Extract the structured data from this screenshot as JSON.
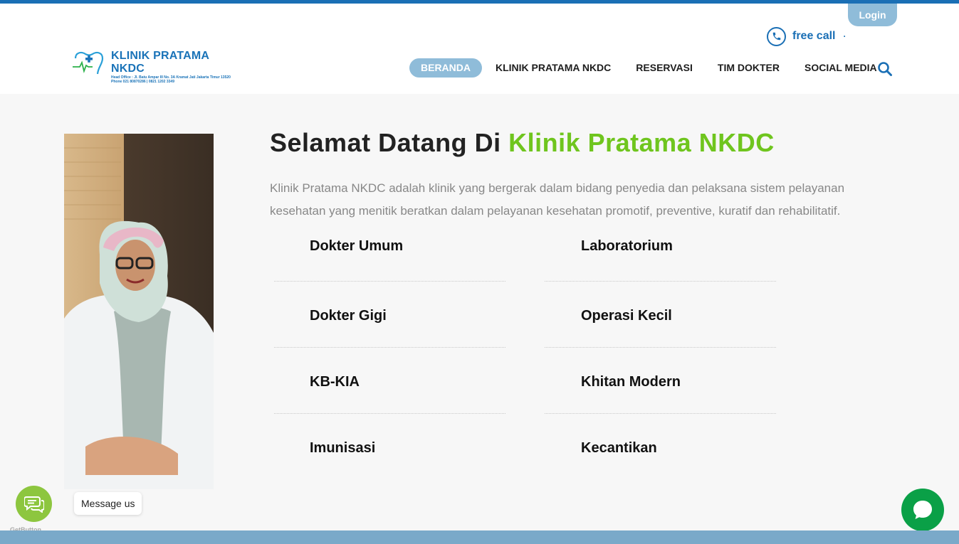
{
  "header": {
    "login_label": "Login",
    "free_call_label": "free call",
    "free_call_suffix": "·"
  },
  "logo": {
    "title": "KLINIK PRATAMA NKDC",
    "subtitle_line1": "Head Office : Jl. Batu Ampar III No. 3A Kramat Jati Jakarta Timur 13520",
    "subtitle_line2": "Phone 021 80870286 | 0821 1202 3349",
    "mark_text": "NKDC"
  },
  "nav": {
    "items": [
      {
        "label": "BERANDA",
        "active": true
      },
      {
        "label": "KLINIK PRATAMA NKDC",
        "active": false
      },
      {
        "label": "RESERVASI",
        "active": false
      },
      {
        "label": "TIM DOKTER",
        "active": false
      },
      {
        "label": "SOCIAL MEDIA",
        "active": false
      }
    ]
  },
  "main": {
    "title_prefix": "Selamat Datang Di ",
    "title_highlight": "Klinik Pratama NKDC",
    "intro": "Klinik Pratama NKDC adalah klinik yang bergerak dalam bidang penyedia dan pelaksana sistem pelayanan kesehatan yang menitik beratkan dalam pelayanan kesehatan promotif, preventive, kuratif dan rehabilitatif.",
    "services": [
      "Dokter Umum",
      "Laboratorium",
      "Dokter Gigi",
      "Operasi Kecil",
      "KB-KIA",
      "Khitan Modern",
      "Imunisasi",
      "Kecantikan"
    ]
  },
  "widgets": {
    "message_label": "Message us",
    "getbutton_label": "GetButton"
  },
  "colors": {
    "brand_blue": "#1a6fb5",
    "accent_green": "#6fc51e",
    "nav_active": "#8fbcd9"
  }
}
